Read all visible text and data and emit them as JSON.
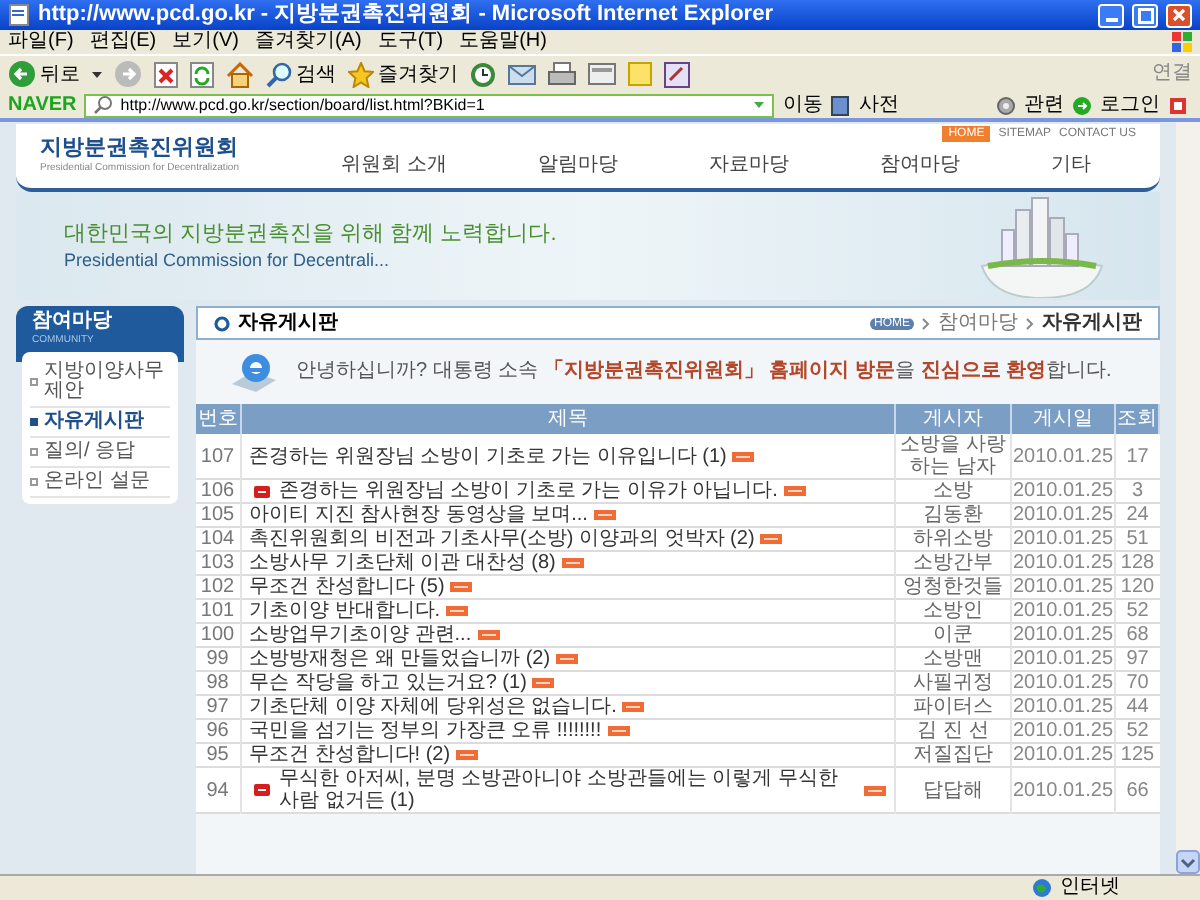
{
  "window": {
    "title": "http://www.pcd.go.kr - 지방분권촉진위원회 - Microsoft Internet Explorer"
  },
  "menu": [
    "파일(F)",
    "편집(E)",
    "보기(V)",
    "즐겨찾기(A)",
    "도구(T)",
    "도움말(H)"
  ],
  "toolbar": {
    "back": "뒤로",
    "search": "검색",
    "favorites": "즐겨찾기",
    "links": "연결"
  },
  "naver_bar": {
    "logo": "NAVER",
    "address": "http://www.pcd.go.kr/section/board/list.html?BKid=1",
    "go": "이동",
    "dictionary": "사전",
    "related": "관련",
    "login": "로그인"
  },
  "site": {
    "logo": "지방분권촉진위원회",
    "logo_subtitle": "Presidential Commission for Decentralization",
    "top_links": [
      "HOME",
      "SITEMAP",
      "CONTACT US"
    ],
    "nav": [
      "위원회 소개",
      "알림마당",
      "자료마당",
      "참여마당",
      "기타"
    ],
    "slogan": "대한민국의 지방분권촉진을 위해 함께 노력합니다.",
    "slogan_english": "Presidential Commission for Decentrali..."
  },
  "sidebar": {
    "title": "참여마당",
    "subtitle": "COMMUNITY",
    "items": [
      {
        "label": "지방이양사무 제안",
        "selected": false
      },
      {
        "label": "자유게시판",
        "selected": true
      },
      {
        "label": "질의/ 응답",
        "selected": false
      },
      {
        "label": "온라인 설문",
        "selected": false
      }
    ]
  },
  "board": {
    "title": "자유게시판",
    "breadcrumb": [
      "HOME",
      "참여마당",
      "자유게시판"
    ],
    "greeting": "안녕하십니까? 대통령 소속 **「지방분권촉진위원회」 홈페이지 방문**을 **진심으로 환영**합니다.",
    "columns": [
      "번호",
      "제목",
      "게시자",
      "게시일",
      "조회"
    ],
    "rows": [
      {
        "no": "107",
        "title": "존경하는 위원장님 소방이 기초로 가는 이유입니다 (1)",
        "reply": false,
        "new": true,
        "writer": "소방을 사랑하는 남자",
        "date": "2010.01.25",
        "views": "17"
      },
      {
        "no": "106",
        "title": "존경하는 위원장님 소방이 기초로 가는 이유가 아닙니다.",
        "reply": true,
        "new": true,
        "writer": "소방",
        "date": "2010.01.25",
        "views": "3"
      },
      {
        "no": "105",
        "title": "아이티 지진 참사현장 동영상을 보며...",
        "reply": false,
        "new": true,
        "writer": "김동환",
        "date": "2010.01.25",
        "views": "24"
      },
      {
        "no": "104",
        "title": "촉진위원회의 비전과 기초사무(소방) 이양과의 엇박자 (2)",
        "reply": false,
        "new": true,
        "writer": "하위소방",
        "date": "2010.01.25",
        "views": "51"
      },
      {
        "no": "103",
        "title": "소방사무 기초단체 이관 대찬성 (8)",
        "reply": false,
        "new": true,
        "writer": "소방간부",
        "date": "2010.01.25",
        "views": "128"
      },
      {
        "no": "102",
        "title": "무조건 찬성합니다 (5)",
        "reply": false,
        "new": true,
        "writer": "엉청한것들",
        "date": "2010.01.25",
        "views": "120"
      },
      {
        "no": "101",
        "title": "기초이양 반대합니다.",
        "reply": false,
        "new": true,
        "writer": "소방인",
        "date": "2010.01.25",
        "views": "52"
      },
      {
        "no": "100",
        "title": "소방업무기초이양 관련...",
        "reply": false,
        "new": true,
        "writer": "이쿤",
        "date": "2010.01.25",
        "views": "68"
      },
      {
        "no": "99",
        "title": "소방방재청은 왜 만들었습니까 (2)",
        "reply": false,
        "new": true,
        "writer": "소방맨",
        "date": "2010.01.25",
        "views": "97"
      },
      {
        "no": "98",
        "title": "무슨 작당을 하고 있는거요? (1)",
        "reply": false,
        "new": true,
        "writer": "사필귀정",
        "date": "2010.01.25",
        "views": "70"
      },
      {
        "no": "97",
        "title": "기초단체 이양 자체에 당위성은 없습니다.",
        "reply": false,
        "new": true,
        "writer": "파이터스",
        "date": "2010.01.25",
        "views": "44"
      },
      {
        "no": "96",
        "title": "국민을 섬기는 정부의 가장큰 오류 !!!!!!!!",
        "reply": false,
        "new": true,
        "writer": "김 진 선",
        "date": "2010.01.25",
        "views": "52"
      },
      {
        "no": "95",
        "title": "무조건 찬성합니다! (2)",
        "reply": false,
        "new": true,
        "writer": "저질집단",
        "date": "2010.01.25",
        "views": "125"
      },
      {
        "no": "94",
        "title": "무식한 아저씨, 분명 소방관아니야 소방관들에는 이렇게 무식한 사람 없거든 (1)",
        "reply": true,
        "new": true,
        "writer": "답답해",
        "date": "2010.01.25",
        "views": "66"
      }
    ]
  },
  "status_bar": {
    "zone": "인터넷"
  }
}
